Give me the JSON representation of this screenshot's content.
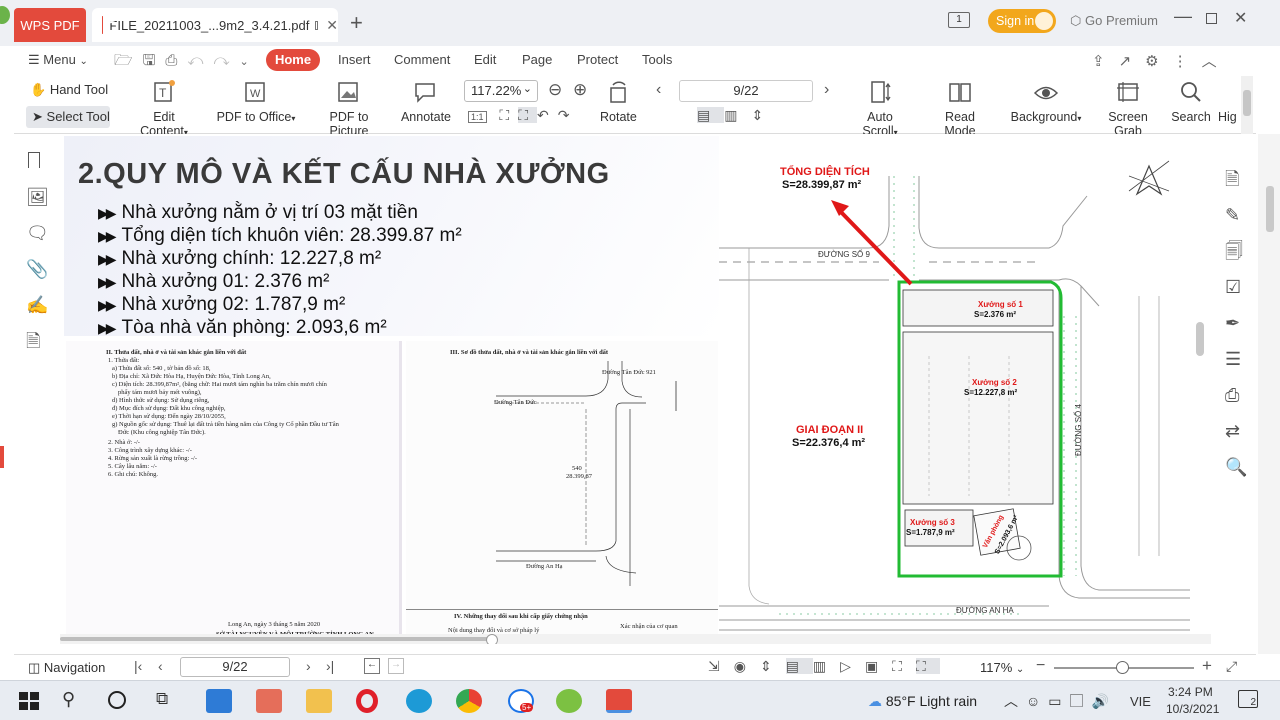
{
  "app": {
    "tab_app": "WPS PDF",
    "tab_doc": "FILE_20211003_...9m2_3.4.21.pdf",
    "new_tab": "+",
    "sign_in": "Sign in",
    "go_premium": "Go Premium",
    "badge": "1"
  },
  "menu": {
    "menu_label": "Menu",
    "items": [
      "Home",
      "Insert",
      "Comment",
      "Edit",
      "Page",
      "Protect",
      "Tools"
    ]
  },
  "toolbar": {
    "hand_tool": "Hand Tool",
    "select_tool": "Select Tool",
    "edit_content": "Edit Content",
    "pdf_to_office": "PDF to Office",
    "pdf_to_picture": "PDF to Picture",
    "annotate": "Annotate",
    "zoom": "117.22%",
    "rotate": "Rotate",
    "page": "9/22",
    "auto_scroll": "Auto Scroll",
    "read_mode": "Read Mode",
    "background": "Background",
    "screen_grab": "Screen Grab",
    "search": "Search",
    "more": "Hig"
  },
  "slide": {
    "title": "2.QUY MÔ VÀ KẾT CẤU NHÀ XƯỞNG",
    "bullets": [
      "Nhà xưởng nằm ở vị trí 03 mặt tiền",
      "Tổng diện tích khuôn viên: 28.399.87 m²",
      "Nhà xưởng chính: 12.227,8 m²",
      "Nhà xưởng 01: 2.376 m²",
      "Nhà xưởng 02: 1.787,9 m²",
      "Tòa nhà văn phòng: 2.093,6 m²"
    ]
  },
  "plan": {
    "total_label": "TỔNG DIỆN TÍCH",
    "total_value": "S=28.399,87 m²",
    "phase2_label": "GIAI ĐOẠN II",
    "phase2_value": "S=22.376,4 m²",
    "w1_label": "Xưởng số 1",
    "w1_value": "S=2.376 m²",
    "w2_label": "Xưởng số 2",
    "w2_value": "S=12.227,8 m²",
    "w3_label": "Xưởng số 3",
    "w3_value": "S=1.787,9 m²",
    "office_label": "Văn phòng",
    "office_value": "S=2.093,6 m²",
    "road9": "ĐƯỜNG SỐ 9",
    "road4": "ĐƯỜNG SỐ 4",
    "road_anha": "ĐƯỜNG AN HẠ"
  },
  "doc1": {
    "h1": "II. Thửa đất, nhà ở và tài sản khác gắn liền với đất",
    "lines": [
      "1. Thửa đất:",
      "a) Thửa đất số: 540 , tờ bản đồ số: 18,",
      "b) Địa chỉ: Xã Đức Hòa Hạ, Huyện Đức Hòa, Tỉnh Long An,",
      "c) Diện tích: 28.399,87m², (bằng chữ: Hai mươi tám nghìn ba trăm chín mươi chín",
      "phẩy tám mươi bảy mét vuông),",
      "d) Hình thức sử dụng: Sử dụng riêng,",
      "đ) Mục đích sử dụng: Đất khu công nghiệp,",
      "e) Thời hạn sử dụng: Đến ngày 28/10/2055,",
      "g) Nguồn gốc sử dụng: Thuê lại đất trả tiền hàng năm của Công ty Cổ phần Đầu tư Tân",
      "Đức (Khu công nghiệp Tân Đức).",
      "2. Nhà ở: -/-",
      "3. Công trình xây dựng khác: -/-",
      "4. Rừng sản xuất là rừng trồng: -/-",
      "5. Cây lâu năm: -/-",
      "6. Ghi chú: Không."
    ],
    "sign_date": "Long An, ngày 3 tháng 5 năm 2020",
    "sign_org": "SỞ TÀI NGUYÊN VÀ MÔI TRƯỜNG TỈNH LONG AN"
  },
  "doc2": {
    "h1": "III. Sơ đồ thửa đất, nhà ở và tài sản khác gắn liền với đất",
    "road_top": "Đường Tân Đức 921",
    "road_left": "Đường Tân Đức",
    "road_bottom": "Đường An Hạ",
    "parcel": "540",
    "area": "28.399,87",
    "h2": "IV. Những thay đổi sau khi cấp giấy chứng nhận",
    "col1": "Nội dung thay đổi và cơ sở pháp lý",
    "col2": "Xác nhận của cơ quan"
  },
  "nav": {
    "label": "Navigation",
    "page": "9/22",
    "zoom": "117%"
  },
  "taskbar": {
    "weather": "85°F  Light rain",
    "lang": "VIE",
    "time": "3:24 PM",
    "date": "10/3/2021",
    "notif": "2",
    "badge": "5+"
  }
}
